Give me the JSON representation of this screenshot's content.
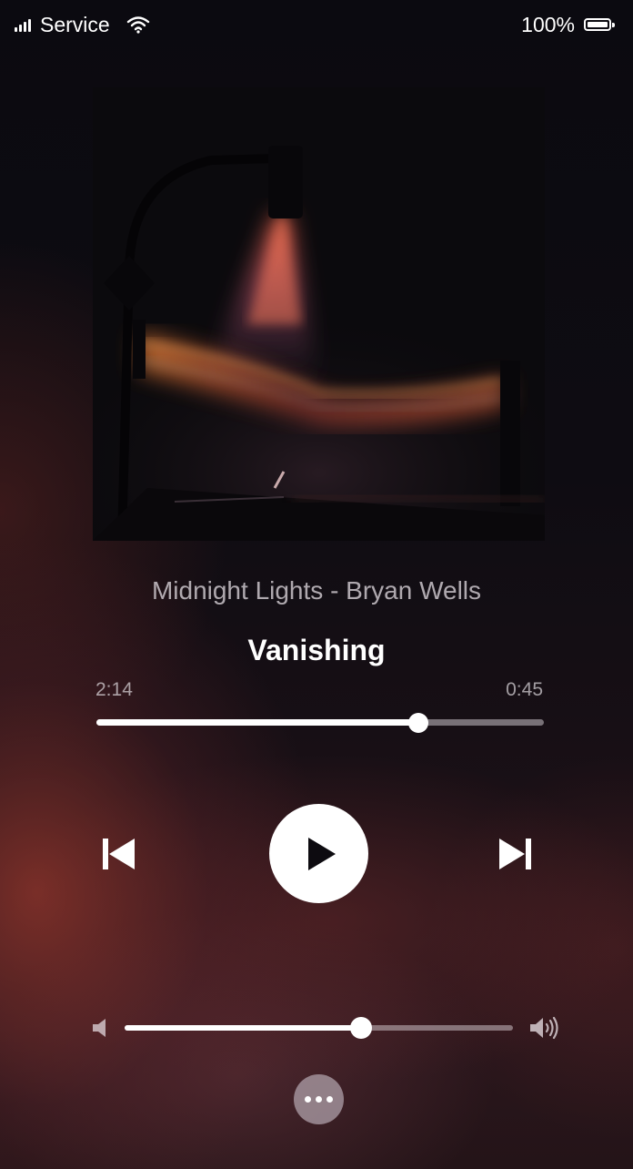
{
  "status_bar": {
    "carrier": "Service",
    "battery_percent": "100%",
    "icons": [
      "signal-icon",
      "wifi-icon",
      "battery-icon"
    ]
  },
  "album": {
    "art_description_icon": "album-art"
  },
  "track": {
    "subtitle": "Midnight Lights - Bryan Wells",
    "title": "Vanishing"
  },
  "playback": {
    "elapsed": "2:14",
    "remaining": "0:45",
    "progress_fraction": 0.72,
    "state": "paused"
  },
  "controls": {
    "previous_icon": "skip-back-icon",
    "play_icon": "play-icon",
    "next_icon": "skip-forward-icon",
    "more_icon": "more-dots-icon"
  },
  "volume": {
    "level_fraction": 0.61,
    "low_icon": "volume-low-icon",
    "high_icon": "volume-high-icon"
  },
  "colors": {
    "accent": "#ffffff",
    "background_dark": "#0d0b10",
    "background_glow": "#96372d"
  }
}
